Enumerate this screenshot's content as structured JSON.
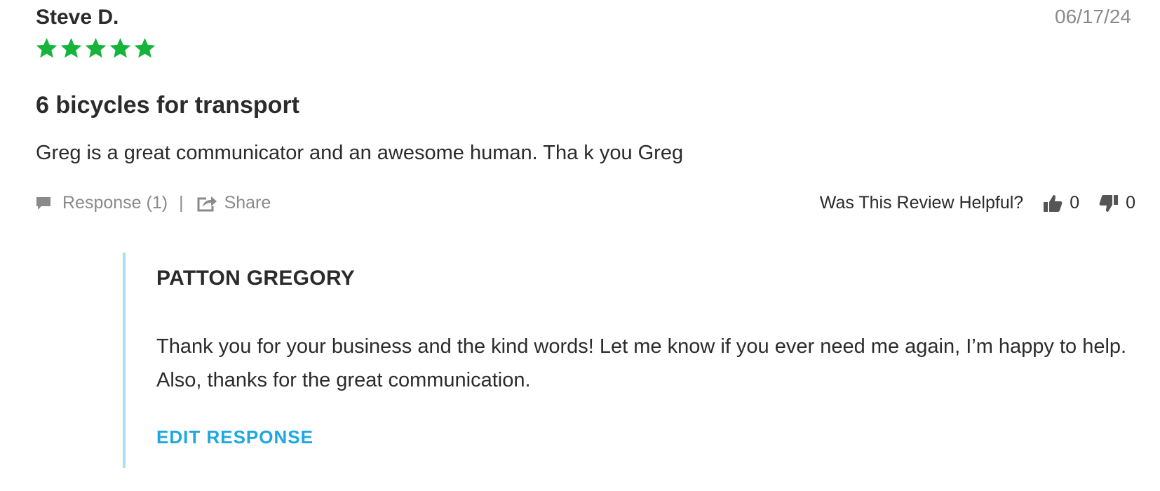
{
  "review": {
    "reviewer_name": "Steve D.",
    "date": "06/17/24",
    "rating": 5,
    "rating_max": 5,
    "star_color": "#17b43c",
    "title": "6 bicycles for transport",
    "body": "Greg is a great communicator and an awesome human. Tha k you Greg"
  },
  "actions": {
    "response_label": "Response (1)",
    "separator": "|",
    "share_label": "Share",
    "helpful_label": "Was This Review Helpful?",
    "thumbs_up_count": "0",
    "thumbs_down_count": "0",
    "icons": [
      "comment-icon",
      "share-icon",
      "thumbs-up-icon",
      "thumbs-down-icon"
    ]
  },
  "response": {
    "responder_name": "PATTON GREGORY",
    "text": "Thank you for your business and the kind words! Let me know if you ever need me again, I’m happy to help. Also, thanks for the great communication.",
    "edit_label": "EDIT RESPONSE",
    "accent_color": "#1ea7e0",
    "border_color": "#a9dff0"
  }
}
